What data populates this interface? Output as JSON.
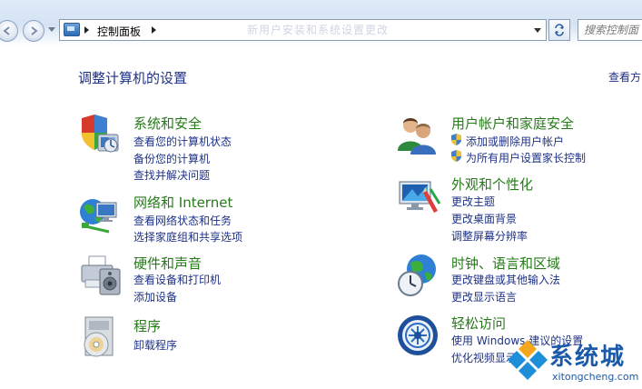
{
  "address_bar": {
    "breadcrumb": "控制面板",
    "search_placeholder": "搜索控制面",
    "ghost_title": "新用户安装和系统设置更改"
  },
  "header": {
    "title": "调整计算机的设置",
    "view_by": "查看方"
  },
  "categories": [
    {
      "title": "系统和安全",
      "icon": "shield-computer-icon",
      "links": [
        "查看您的计算机状态",
        "备份您的计算机",
        "查找并解决问题"
      ]
    },
    {
      "title": "网络和 Internet",
      "icon": "network-globe-icon",
      "links": [
        "查看网络状态和任务",
        "选择家庭组和共享选项"
      ]
    },
    {
      "title": "硬件和声音",
      "icon": "printer-icon",
      "links": [
        "查看设备和打印机",
        "添加设备"
      ]
    },
    {
      "title": "程序",
      "icon": "programs-disc-icon",
      "links": [
        "卸载程序"
      ]
    },
    {
      "title": "用户帐户和家庭安全",
      "icon": "users-icon",
      "links": [
        "添加或删除用户帐户",
        "为所有用户设置家长控制"
      ]
    },
    {
      "title": "外观和个性化",
      "icon": "appearance-monitor-icon",
      "links": [
        "更改主题",
        "更改桌面背景",
        "调整屏幕分辨率"
      ]
    },
    {
      "title": "时钟、语言和区域",
      "icon": "clock-globe-icon",
      "links": [
        "更改键盘或其他输入法",
        "更改显示语言"
      ]
    },
    {
      "title": "轻松访问",
      "icon": "ease-of-access-icon",
      "links": [
        "使用 Windows 建议的设置",
        "优化视频显示"
      ]
    }
  ],
  "watermark": {
    "text": "系统城",
    "subtext": "xitongcheng.com"
  },
  "colors": {
    "category_title": "#267a19",
    "link": "#1e3287",
    "address_bar_bg": "#d5e3f4"
  }
}
